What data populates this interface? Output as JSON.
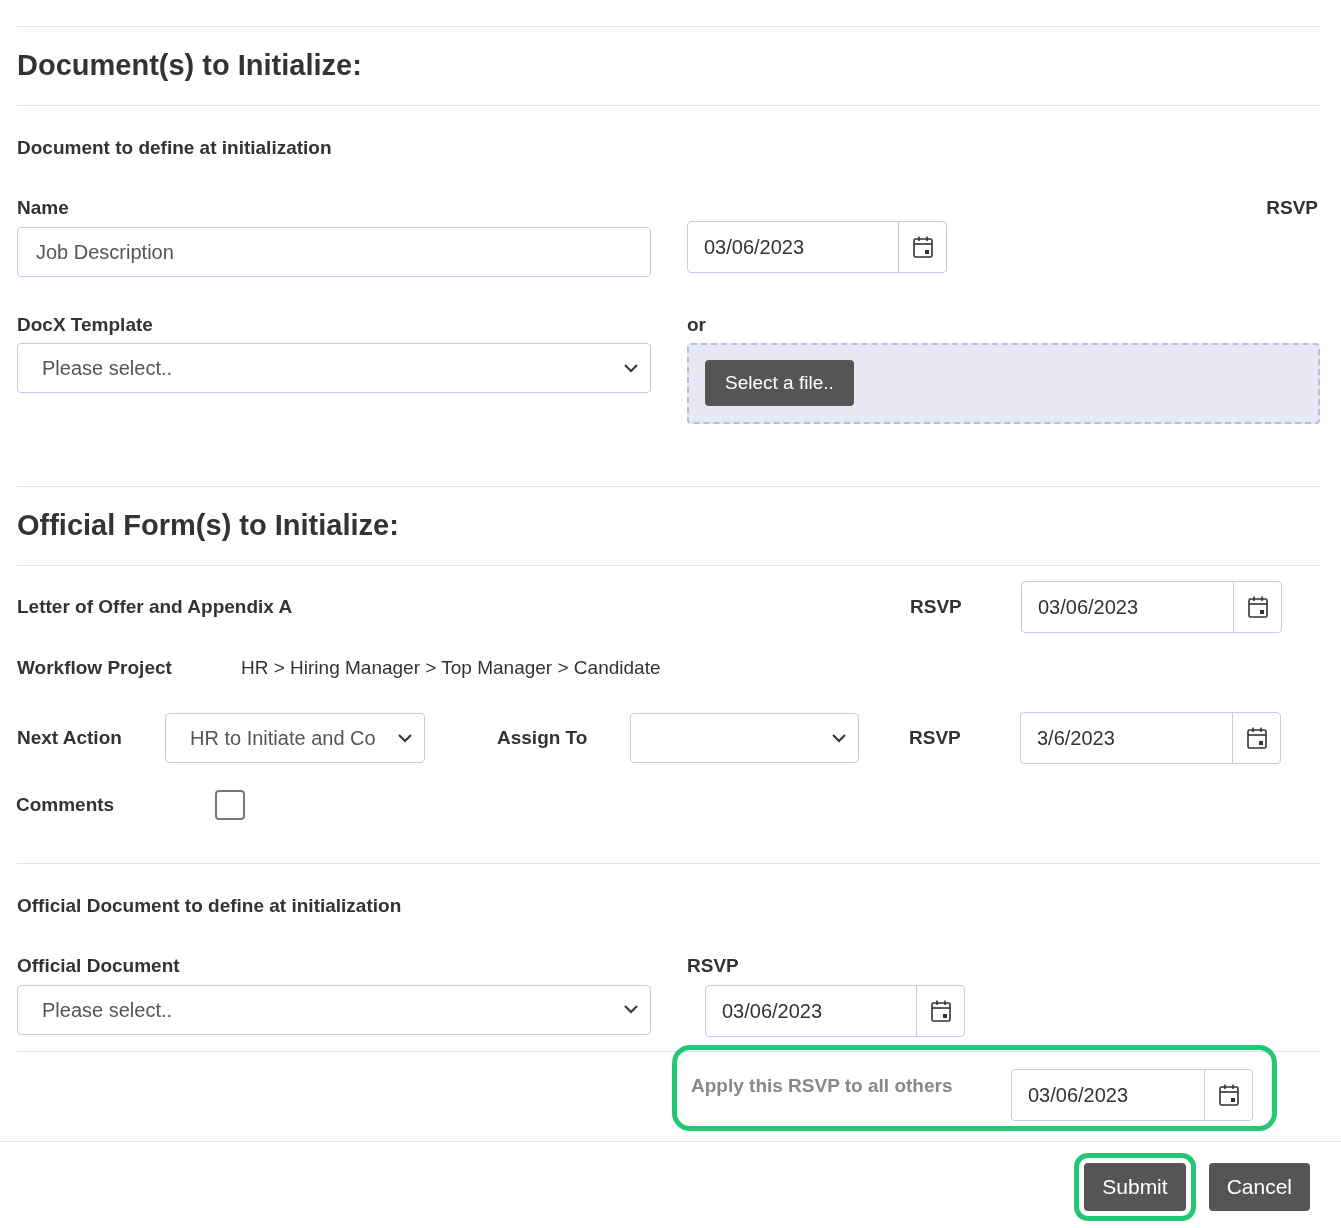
{
  "documents": {
    "title": "Document(s) to Initialize:",
    "subtitle": "Document to define at initialization",
    "name": {
      "label": "Name",
      "value": "Job Description"
    },
    "rsvp": {
      "label": "RSVP",
      "value": "03/06/2023"
    },
    "template": {
      "label": "DocX Template",
      "value": "Please select.."
    },
    "or_label": "or",
    "file_button": "Select a file.."
  },
  "official_forms": {
    "title": "Official Form(s) to Initialize:",
    "form_name": "Letter of Offer and Appendix A",
    "rsvp": {
      "label": "RSVP",
      "value": "03/06/2023"
    },
    "workflow": {
      "label": "Workflow Project",
      "value": "HR > Hiring Manager > Top Manager > Candidate"
    },
    "next_action": {
      "label": "Next Action",
      "value": "HR to Initiate and Co"
    },
    "assign_to": {
      "label": "Assign To"
    },
    "action_rsvp": {
      "label": "RSVP",
      "value": "3/6/2023"
    },
    "comments": {
      "label": "Comments",
      "checked": false
    }
  },
  "official_document": {
    "subtitle": "Official Document to define at initialization",
    "document": {
      "label": "Official Document",
      "value": "Please select.."
    },
    "rsvp": {
      "label": "RSVP",
      "value": "03/06/2023"
    }
  },
  "apply_all": {
    "label": "Apply this RSVP to all others",
    "value": "03/06/2023",
    "highlighted": true
  },
  "buttons": [
    {
      "label": "Submit",
      "highlighted": true
    },
    {
      "label": "Cancel",
      "highlighted": false
    }
  ]
}
